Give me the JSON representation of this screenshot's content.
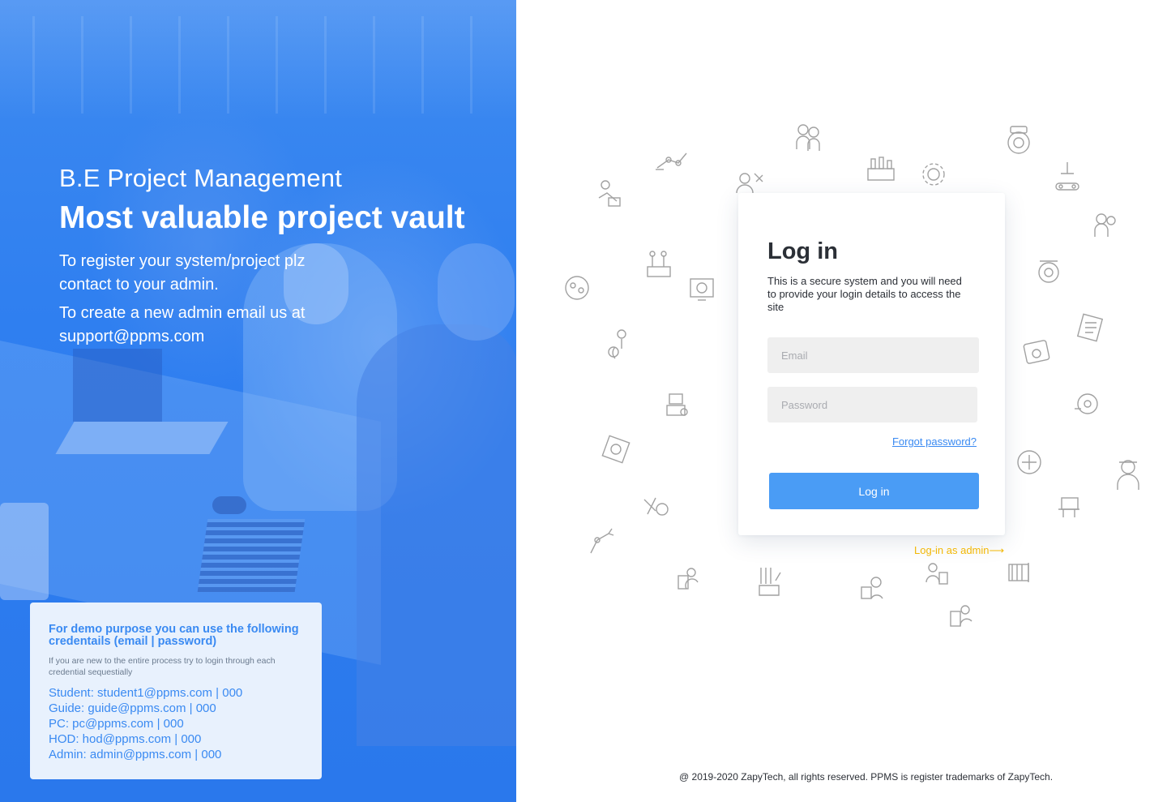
{
  "hero": {
    "subtitle": "B.E Project Management",
    "title": "Most valuable project vault",
    "register_text": "To register your system/project plz contact to your admin.",
    "admin_text": "To create a new admin email us at support@ppms.com",
    "accent_color": "#2f7ff0"
  },
  "demo": {
    "title": "For demo purpose you can use the following credentails (email | password)",
    "note": "If you are new to the entire process try to login through each credential sequestially",
    "credentials": [
      "Student: student1@ppms.com | 000",
      "Guide: guide@ppms.com | 000",
      "PC: pc@ppms.com | 000",
      "HOD: hod@ppms.com | 000",
      "Admin: admin@ppms.com | 000"
    ]
  },
  "login": {
    "title": "Log in",
    "description": "This is a secure system and you will need to provide your login details to access the site",
    "email_placeholder": "Email",
    "password_placeholder": "Password",
    "forgot_label": "Forgot password?",
    "button_label": "Log in",
    "button_color": "#4a9cf5",
    "admin_link": "Log-in as admin⟶",
    "admin_link_color": "#f2b705"
  },
  "background_icons": [
    "robot-arm-icon",
    "engineer-icon",
    "gear-icon",
    "factory-icon",
    "conveyor-icon",
    "circuit-icon",
    "turbine-icon",
    "monitor-icon",
    "worker-icon"
  ],
  "footer": {
    "text": "@ 2019-2020 ZapyTech, all rights reserved. PPMS is register trademarks of ZapyTech."
  }
}
